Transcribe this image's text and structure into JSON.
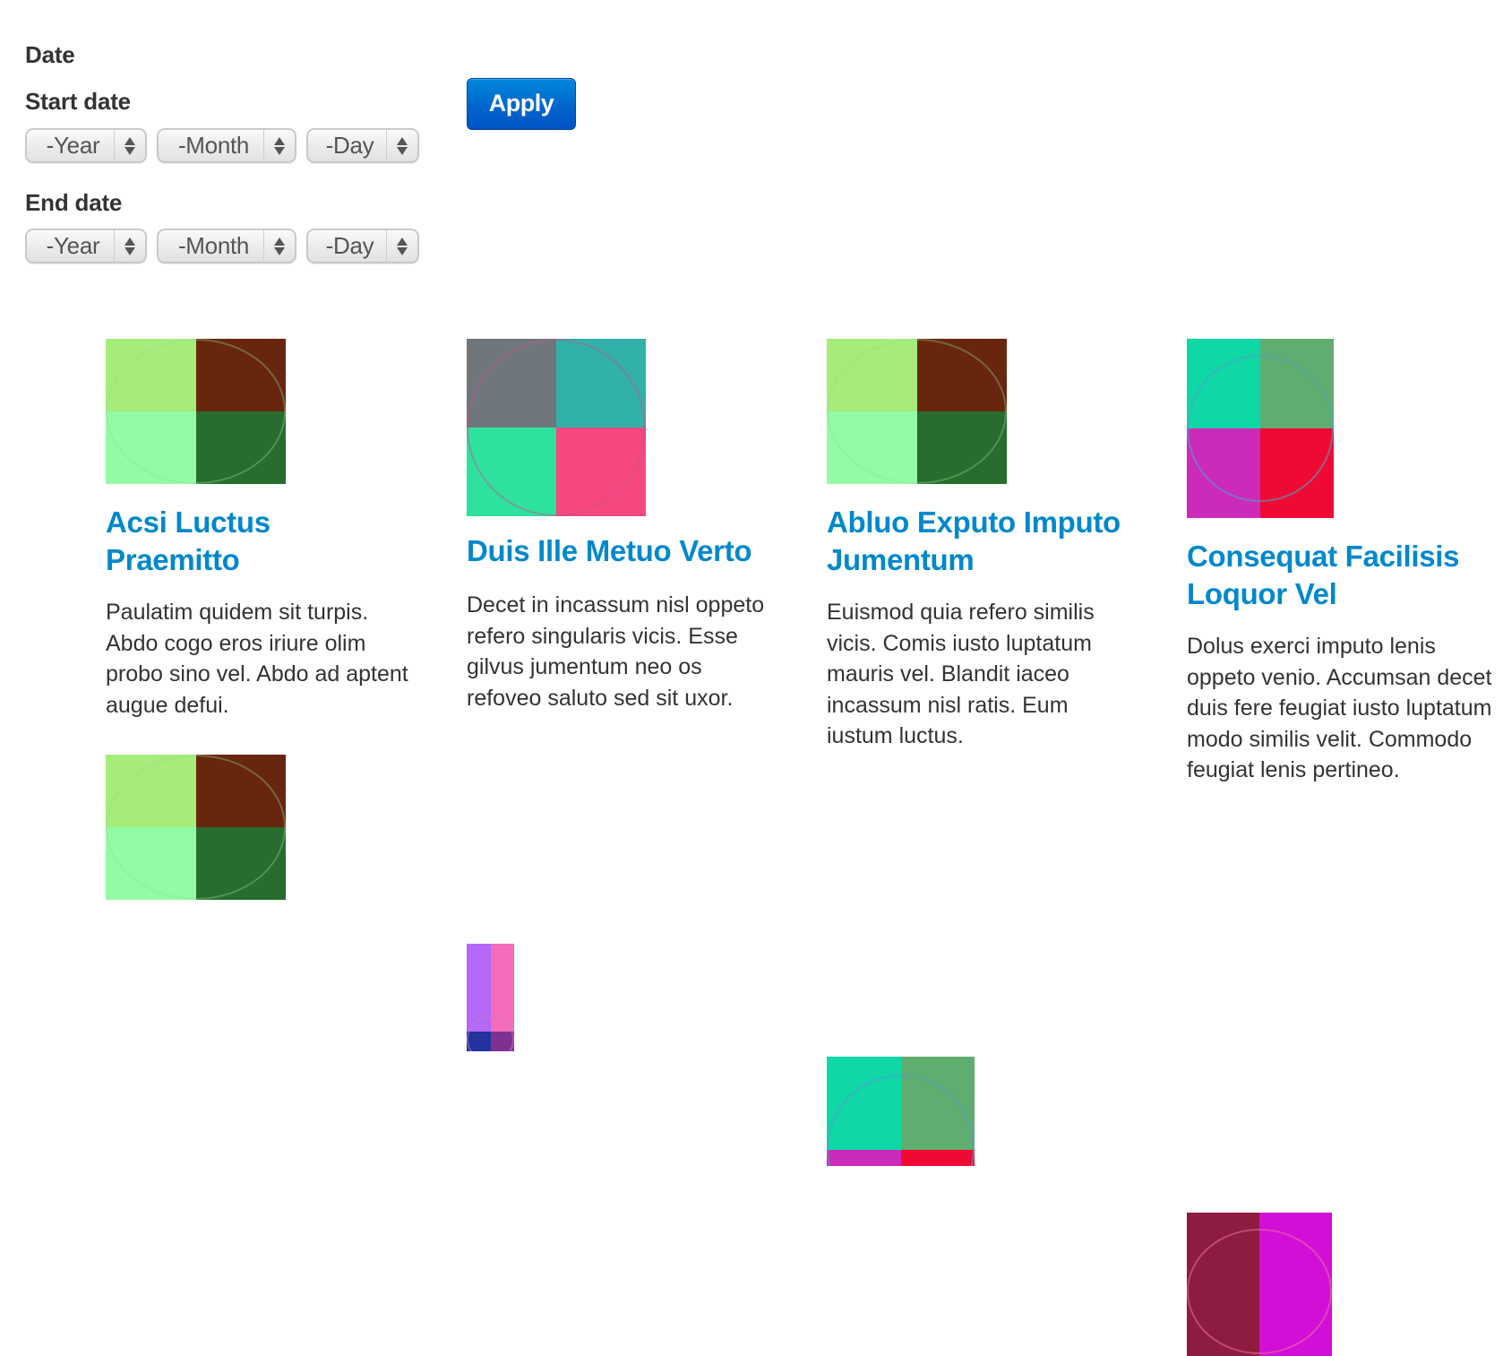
{
  "filters": {
    "section_label": "Date",
    "start": {
      "label": "Start date",
      "year": "-Year",
      "month": "-Month",
      "day": "-Day"
    },
    "end": {
      "label": "End date",
      "year": "-Year",
      "month": "-Month",
      "day": "-Day"
    },
    "apply_label": "Apply"
  },
  "colors": {
    "link": "#0088cc",
    "button": "#0066cc",
    "text": "#333333"
  },
  "cards": [
    {
      "title": "Acsi Luctus Praemitto",
      "body": "Paulatim quidem sit turpis. Abdo cogo eros iriure olim probo sino vel. Abdo ad aptent augue defui.",
      "thumb": {
        "tl": "#a6ec7a",
        "tr": "#68260f",
        "bl": "#93fba6",
        "br": "#286c2e",
        "ring": "rgba(150,220,150,0.35)"
      }
    },
    {
      "title": "Duis Ille Metuo Verto",
      "body": "Decet in incassum nisl oppeto refero singularis vicis. Esse gilvus jumentum neo os refoveo saluto sed sit uxor.",
      "thumb": {
        "tl": "#6f777c",
        "tr": "#31b1a9",
        "bl": "#2ee29e",
        "br": "#f5487f",
        "ring": "rgba(200,80,140,0.45)"
      }
    },
    {
      "title": "Abluo Exputo Imputo Jumentum",
      "body": "Euismod quia refero similis vicis. Comis iusto luptatum mauris vel. Blandit iaceo incassum nisl ratis. Eum iustum luctus.",
      "thumb": {
        "tl": "#a6ec7a",
        "tr": "#68260f",
        "bl": "#93fba6",
        "br": "#286c2e",
        "ring": "rgba(150,220,150,0.35)"
      }
    },
    {
      "title": "Consequat Facilisis Loquor Vel",
      "body": "Dolus exerci imputo lenis oppeto venio. Accumsan decet duis fere feugiat iusto luptatum modo similis velit. Commodo feugiat lenis pertineo.",
      "thumb": {
        "tl": "#0fd8a6",
        "tr": "#60ae6f",
        "bl": "#cc2ab8",
        "br": "#ef0a33",
        "ring": "rgba(80,160,200,0.6)"
      }
    }
  ],
  "next_row_thumbs": [
    {
      "tl": "#a6ec7a",
      "tr": "#68260f",
      "bl": "#93fba6",
      "br": "#286c2e",
      "ring": "rgba(150,220,150,0.35)"
    },
    {
      "tl": "#b468f7",
      "tr": "#f46cba",
      "bl": "#23329c",
      "br": "#7e3190",
      "ring": "rgba(200,120,200,0.5)"
    },
    {
      "tl": "#0fd8a6",
      "tr": "#60ae6f",
      "bl": "#cc2ab8",
      "br": "#ef0a33",
      "ring": "rgba(80,160,200,0.6)"
    },
    {
      "tl": "#8e1c40",
      "tr": "#d10fd6",
      "bl": "#8e1c40",
      "br": "#d10fd6",
      "ring": "rgba(240,120,160,0.5)"
    }
  ]
}
